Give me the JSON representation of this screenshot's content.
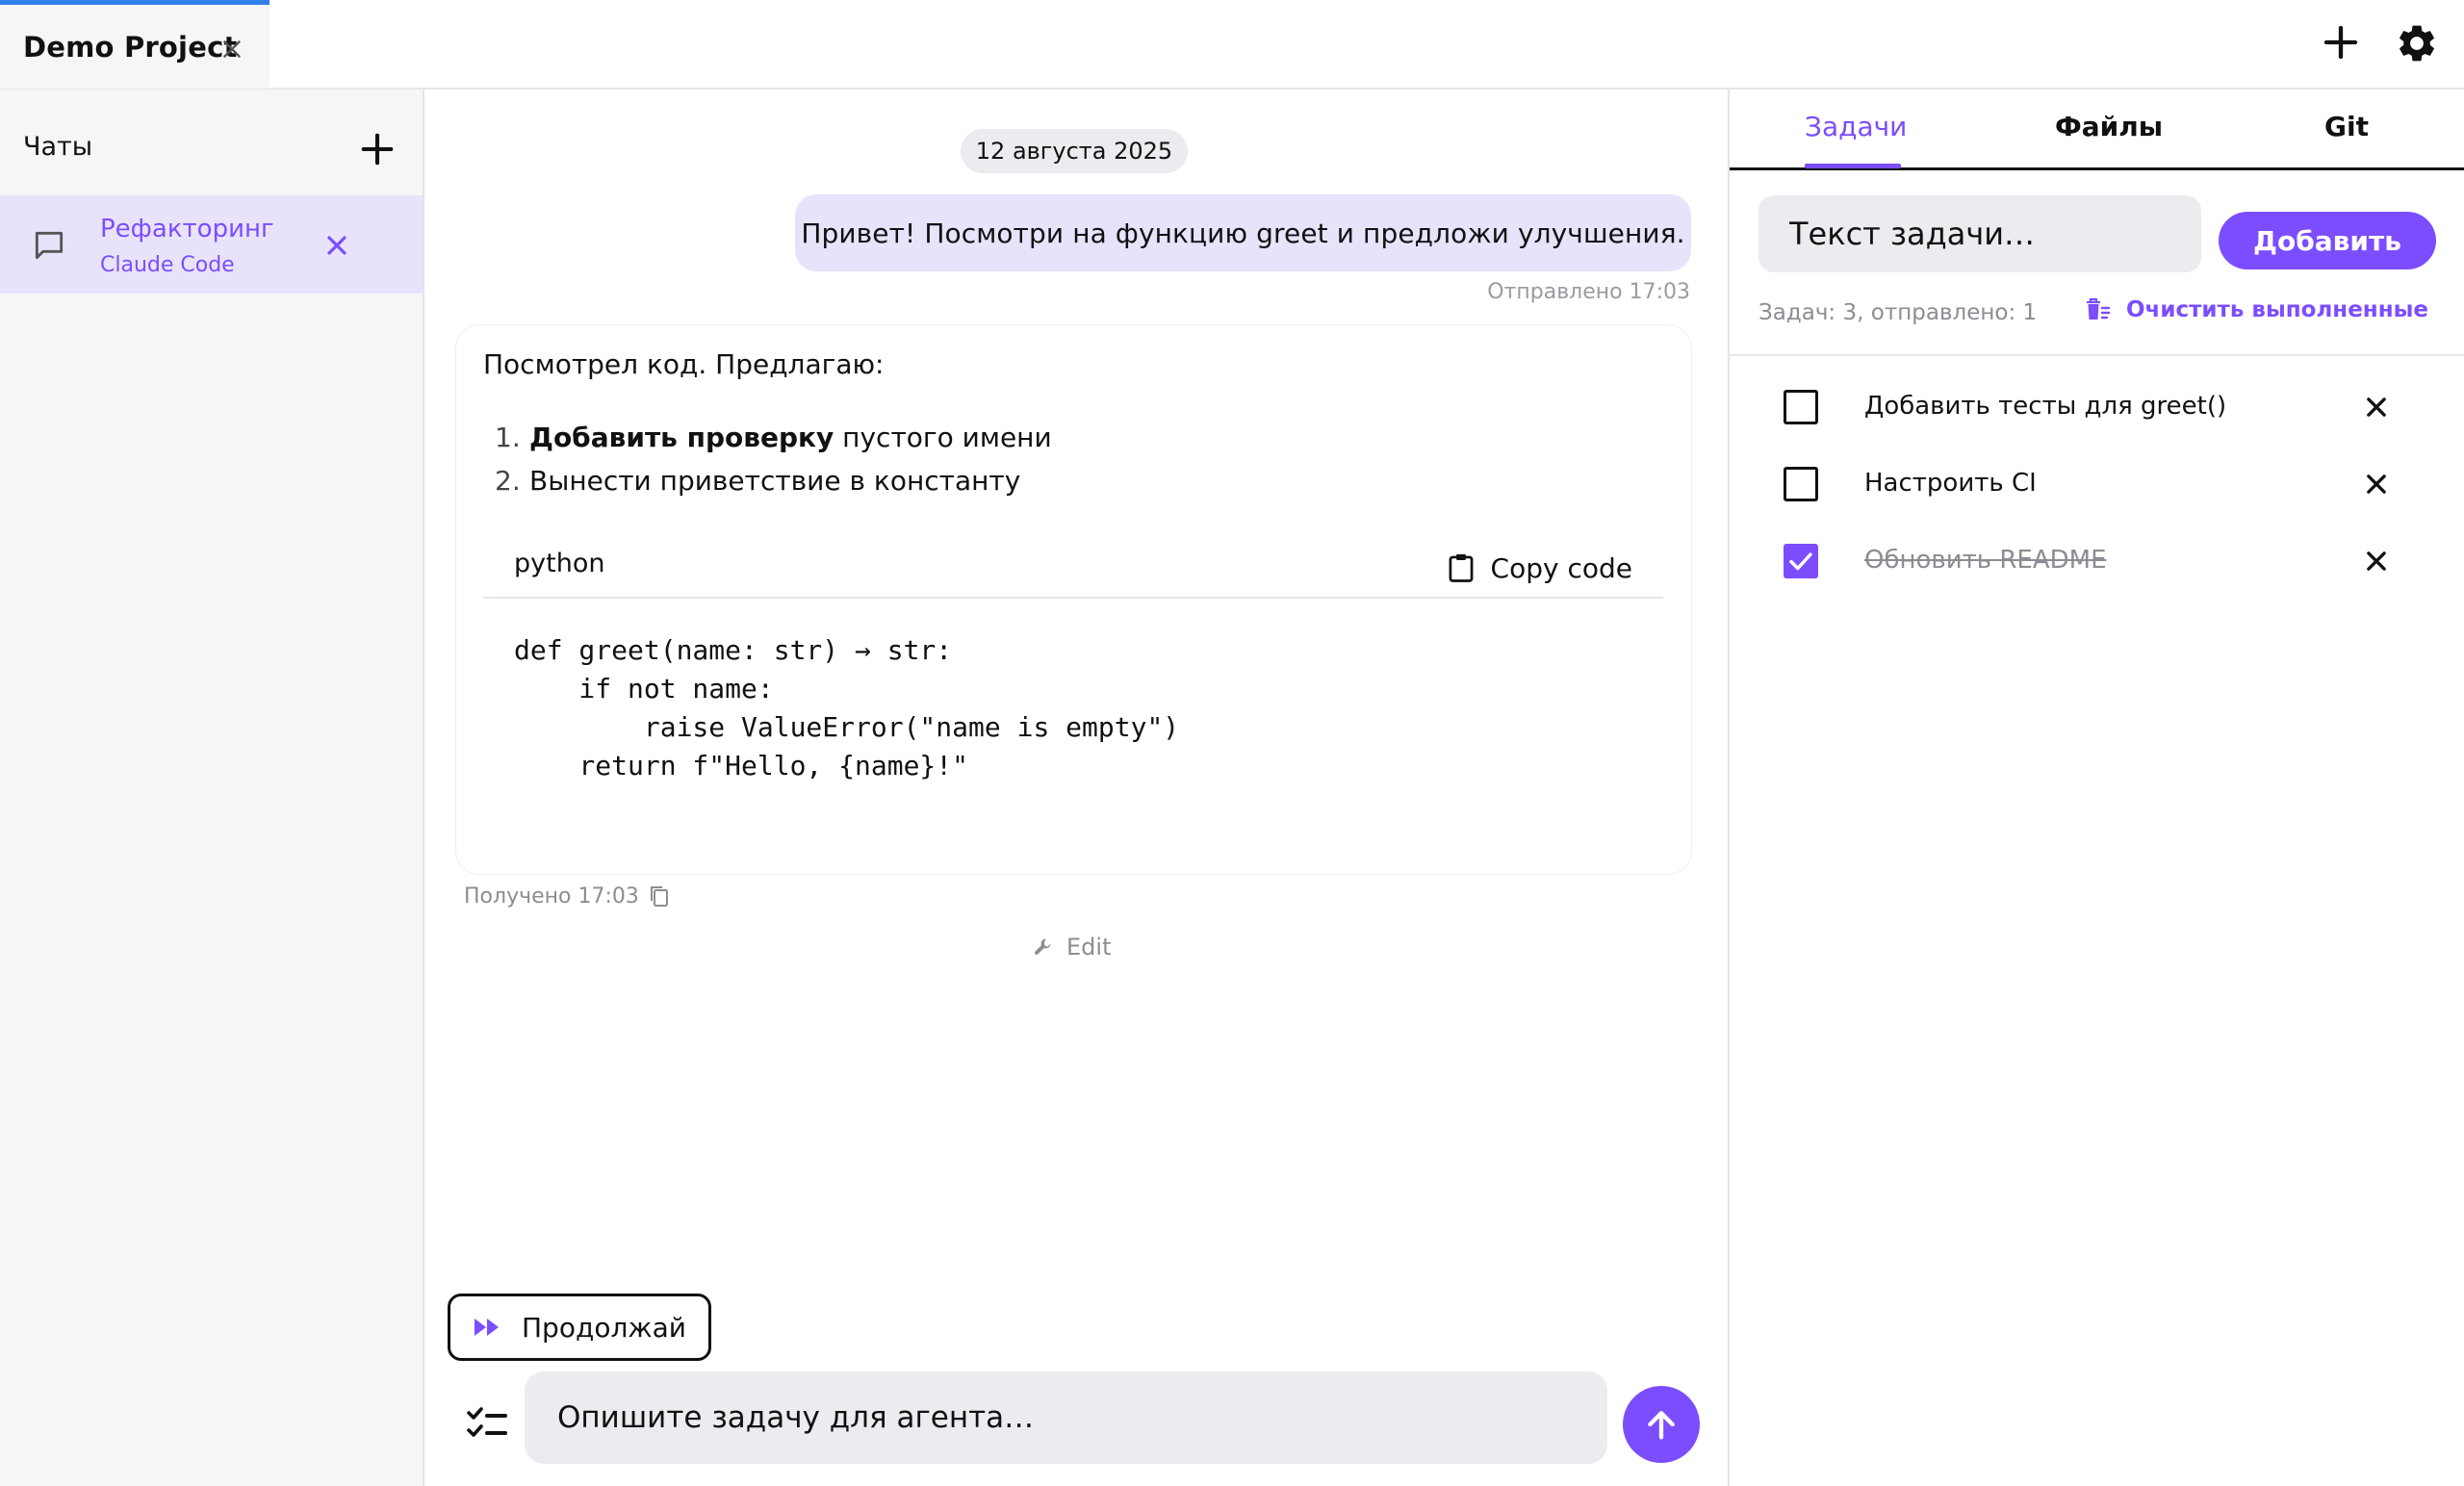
{
  "topbar": {
    "project_tab": "Demo Project",
    "accent_color": "#2f80ed",
    "icons": [
      "close-icon",
      "plus-icon",
      "gear-icon"
    ]
  },
  "sidebar": {
    "title": "Чаты",
    "chats": [
      {
        "name": "Рефакторинг",
        "agent": "Claude Code",
        "active": true
      }
    ]
  },
  "chat": {
    "date": "12 августа 2025",
    "user_message": "Привет! Посмотри на функцию greet и предложи улучшения.",
    "user_meta": "Отправлено 17:03",
    "agent_intro": "Посмотрел код. Предлагаю:",
    "agent_list": [
      {
        "num": "1.",
        "bold": "Добавить проверку",
        "rest": " пустого имени"
      },
      {
        "num": "2.",
        "bold": "",
        "rest": "Вынести приветствие в константу"
      }
    ],
    "code_lang": "python",
    "copy_code_label": "Copy code",
    "code": "def greet(name: str) → str:\n    if not name:\n        raise ValueError(\"name is empty\")\n    return f\"Hello, {name}!\"",
    "agent_meta": "Получено 17:03",
    "tool_label": "Edit",
    "continue_label": "Продолжай",
    "input_placeholder": "Опишите задачу для агента…"
  },
  "tasks_panel": {
    "tabs": [
      {
        "label": "Задачи",
        "active": true
      },
      {
        "label": "Файлы",
        "active": false
      },
      {
        "label": "Git",
        "active": false
      }
    ],
    "input_placeholder": "Текст задачи…",
    "add_label": "Добавить",
    "summary": "Задач: 3, отправлено: 1",
    "clear_label": "Очистить выполненные",
    "tasks": [
      {
        "text": "Добавить тесты для greet()",
        "done": false
      },
      {
        "text": "Настроить CI",
        "done": false
      },
      {
        "text": "Обновить README",
        "done": true
      }
    ]
  },
  "colors": {
    "accent": "#7c4dff",
    "accent_light": "#e8e3fb",
    "tab_bar_accent": "#2f80ed"
  }
}
